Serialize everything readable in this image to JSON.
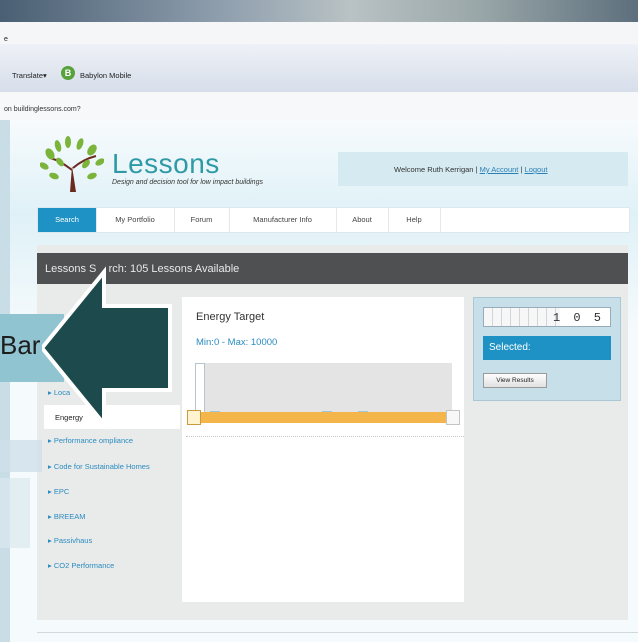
{
  "browser": {
    "menu_fragment": "e",
    "toolbar": {
      "translate": "Translate",
      "bookmark_icon": "B",
      "bookmark": "Babylon Mobile"
    },
    "notice": "on buildinglessons.com?"
  },
  "site": {
    "logo_title": "Lessons",
    "logo_subtitle": "Design and decision tool for low impact buildings",
    "welcome_text": "Welcome Ruth Kerrigan |",
    "my_account": "My Account",
    "separator": "|",
    "logout": "Logout"
  },
  "nav": {
    "tabs": [
      {
        "label": "Search",
        "active": true
      },
      {
        "label": "My Portfolio"
      },
      {
        "label": "Forum"
      },
      {
        "label": "Manufacturer Info"
      },
      {
        "label": "About"
      },
      {
        "label": "Help"
      }
    ]
  },
  "panel": {
    "header": "Lessons S    rch: 105 Lessons Available"
  },
  "sidebar": {
    "items": [
      {
        "label": "▸ Loca"
      },
      {
        "label": "▸ Performance   ompliance"
      },
      {
        "label": "▸ Code for Sustainable Homes"
      },
      {
        "label": "▸ EPC"
      },
      {
        "label": "▸ BREEAM"
      },
      {
        "label": "▸ Passivhaus"
      },
      {
        "label": "▸ CO2 Performance"
      }
    ],
    "selected": "Engergy       t"
  },
  "filter": {
    "title": "Energy Target",
    "range_text": "Min:0 - Max: 10000",
    "min": 0,
    "max": 10000
  },
  "results": {
    "count": "1 0 5",
    "selected_label": "Selected:",
    "view_button": "View Results"
  },
  "callout": {
    "label": "Bar"
  },
  "colors": {
    "accent": "#1f92c5",
    "slider": "#f4b54a",
    "arrow": "#1d4a4c",
    "logo": "#2e9aa6"
  }
}
